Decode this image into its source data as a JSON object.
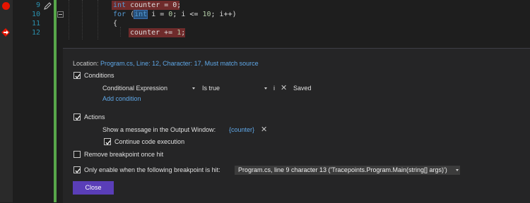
{
  "editor": {
    "lines": [
      {
        "number": "9",
        "active": true
      },
      {
        "number": "10"
      },
      {
        "number": "11"
      },
      {
        "number": "12"
      }
    ],
    "code": {
      "line9_type": "int",
      "line9_rest": " counter = 0;",
      "line10_kw": "for",
      "line10_open": " (",
      "line10_int": "int",
      "line10_a": " i = ",
      "line10_n0": "0",
      "line10_b": "; i <= ",
      "line10_n10": "10",
      "line10_c": "; i++)",
      "line11": "{",
      "line12_a": "counter += ",
      "line12_n1": "1",
      "line12_b": ";"
    },
    "colors": {
      "breakpoint": "#e51400",
      "line_highlight": "#6f2b2b",
      "change_bar": "#57a64a"
    }
  },
  "panel": {
    "location_label": "Location:",
    "location_value": "Program.cs, Line: 12, Character: 17, Must match source",
    "conditions_label": "Conditions",
    "condition_type": "Conditional Expression",
    "condition_mode": "Is true",
    "condition_info": "i",
    "condition_status": "Saved",
    "add_condition": "Add condition",
    "actions_label": "Actions",
    "action_message_label": "Show a message in the Output Window:",
    "action_message_value": "{counter}",
    "continue_label": "Continue code execution",
    "remove_label": "Remove breakpoint once hit",
    "only_enable_label": "Only enable when the following breakpoint is hit:",
    "dependent_breakpoint": "Program.cs, line 9 character 13 ('Tracepoints.Program.Main(string[] args)')",
    "close_label": "Close",
    "accent": "#5a3eb8",
    "link_color": "#5fa8e8"
  }
}
